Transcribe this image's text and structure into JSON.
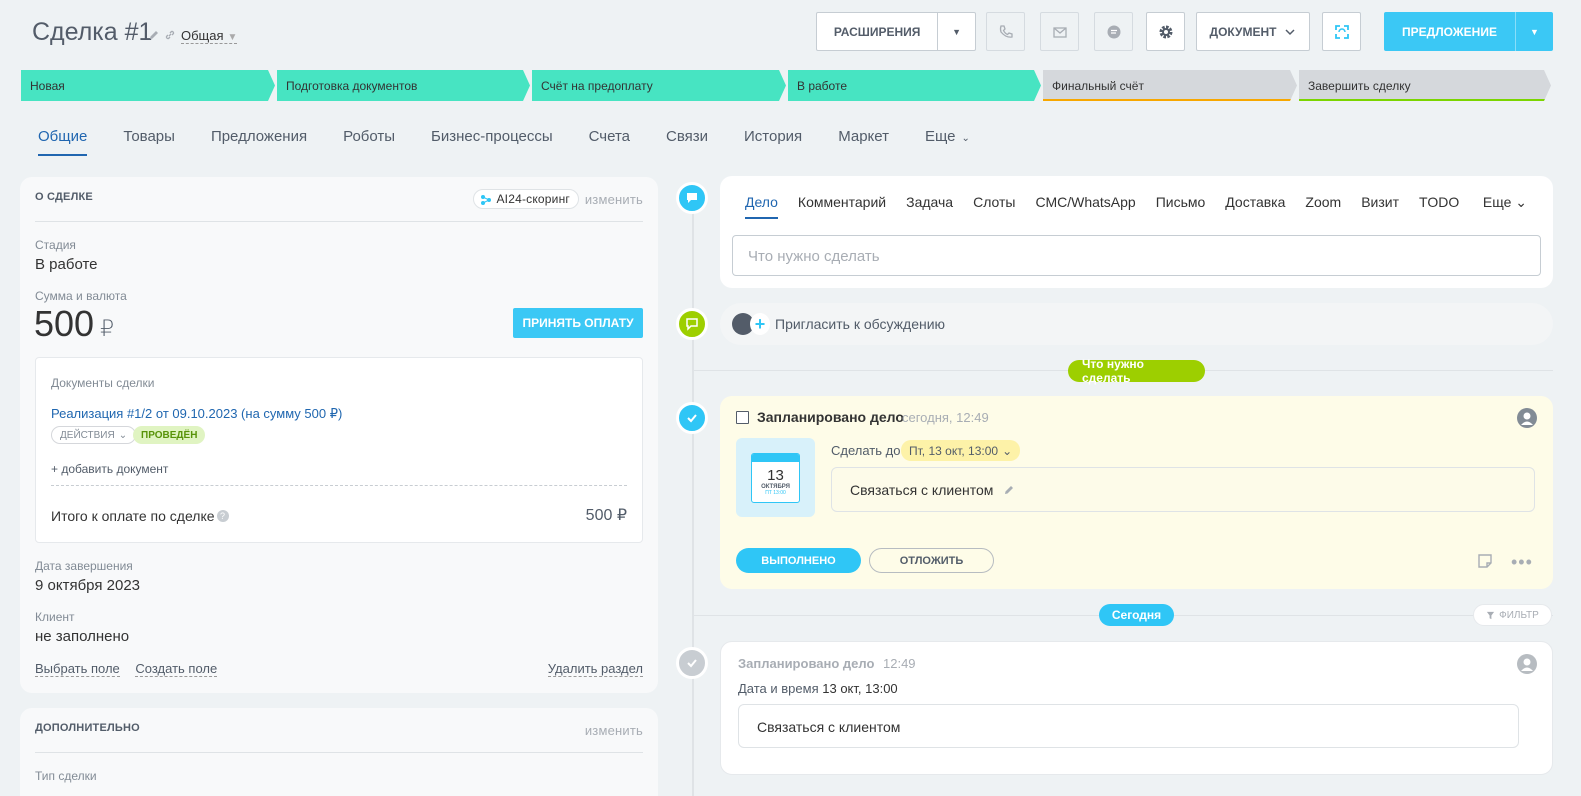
{
  "header": {
    "title": "Сделка #1",
    "category": "Общая",
    "extensions_label": "РАСШИРЕНИЯ",
    "document_label": "ДОКУМЕНТ",
    "offer_label": "ПРЕДЛОЖЕНИЕ"
  },
  "stages": [
    {
      "label": "Новая",
      "state": "done"
    },
    {
      "label": "Подготовка документов",
      "state": "done"
    },
    {
      "label": "Счёт на предоплату",
      "state": "done"
    },
    {
      "label": "В работе",
      "state": "done"
    },
    {
      "label": "Финальный счёт",
      "state": "todo"
    },
    {
      "label": "Завершить сделку",
      "state": "todo"
    }
  ],
  "tabs": [
    "Общие",
    "Товары",
    "Предложения",
    "Роботы",
    "Бизнес-процессы",
    "Счета",
    "Связи",
    "История",
    "Маркет",
    "Еще"
  ],
  "deal": {
    "section_title": "О СДЕЛКЕ",
    "ai_badge": "AI24-скоринг",
    "change": "изменить",
    "stage_label": "Стадия",
    "stage_value": "В работе",
    "amount_label": "Сумма и валюта",
    "amount": "500",
    "currency": "₽",
    "pay_button": "ПРИНЯТЬ ОПЛАТУ",
    "docs": {
      "label": "Документы сделки",
      "link": "Реализация #1/2 от 09.10.2023 (на сумму 500 ₽)",
      "actions": "ДЕЙСТВИЯ",
      "status": "ПРОВЕДЁН",
      "add": "+ добавить документ",
      "total_label": "Итого к оплате по сделке",
      "total_value": "500 ₽"
    },
    "close_date_label": "Дата завершения",
    "close_date": "9 октября 2023",
    "client_label": "Клиент",
    "client_value": "не заполнено",
    "select_field": "Выбрать поле",
    "create_field": "Создать поле",
    "delete_section": "Удалить раздел"
  },
  "extra": {
    "section_title": "ДОПОЛНИТЕЛЬНО",
    "change": "изменить",
    "type_label": "Тип сделки"
  },
  "editor": {
    "tabs": [
      "Дело",
      "Комментарий",
      "Задача",
      "Слоты",
      "СМС/WhatsApp",
      "Письмо",
      "Доставка",
      "Zoom",
      "Визит",
      "TODO"
    ],
    "more": "Еще",
    "placeholder": "Что нужно сделать"
  },
  "invite": "Пригласить к обсуждению",
  "todo_pill": "Что нужно сделать",
  "todo": {
    "title": "Запланировано дело",
    "time": "сегодня, 12:49",
    "cal_day": "13",
    "cal_month": "ОКТЯБРЯ",
    "cal_weekday": "ПТ 13:00",
    "due_label": "Сделать до",
    "due": "Пт, 13 окт, 13:00",
    "description": "Связаться с клиентом",
    "done_button": "ВЫПОЛНЕНО",
    "postpone_button": "ОТЛОЖИТЬ"
  },
  "today_pill": "Сегодня",
  "filter": "ФИЛЬТР",
  "history": {
    "title": "Запланировано дело",
    "time": "12:49",
    "datetime_label": "Дата и время",
    "datetime": "13 окт, 13:00",
    "description": "Связаться с клиентом"
  },
  "colors": {
    "accent": "#3bc8f5",
    "stage_done": "#47e4c2",
    "stage_todo": "#d5d8dc",
    "pill_green": "#9dcf00",
    "link": "#2066b0"
  }
}
